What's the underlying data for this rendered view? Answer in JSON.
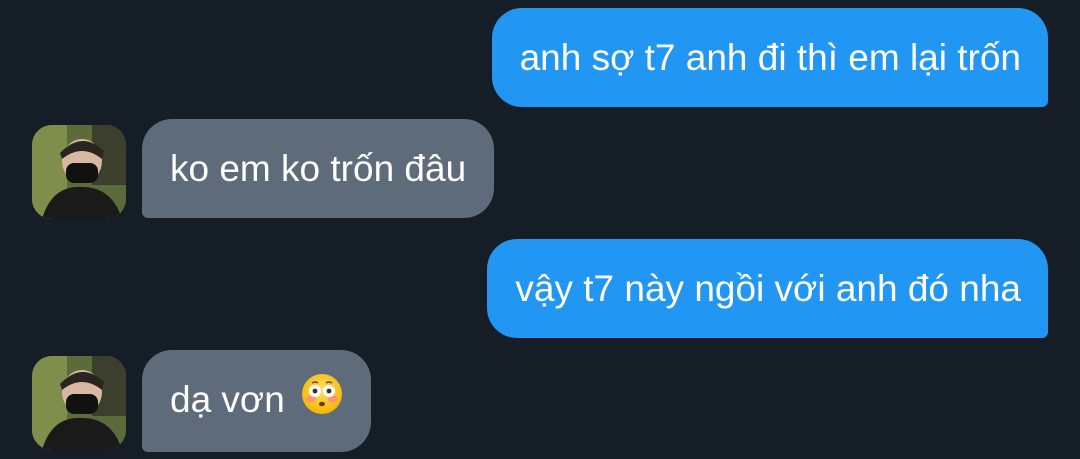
{
  "messages": [
    {
      "direction": "outgoing",
      "text": "anh sợ t7 anh đi thì em lại trốn"
    },
    {
      "direction": "incoming",
      "text": "ko em ko trốn đâu"
    },
    {
      "direction": "outgoing",
      "text": "vậy t7 này ngồi với anh đó nha"
    },
    {
      "direction": "incoming",
      "text": "dạ vơn",
      "emoji": "flushed-face-emoji"
    }
  ],
  "colors": {
    "background": "#151e27",
    "outgoing_bubble": "#2196f3",
    "incoming_bubble": "#5d6b7a",
    "text": "#ffffff"
  }
}
